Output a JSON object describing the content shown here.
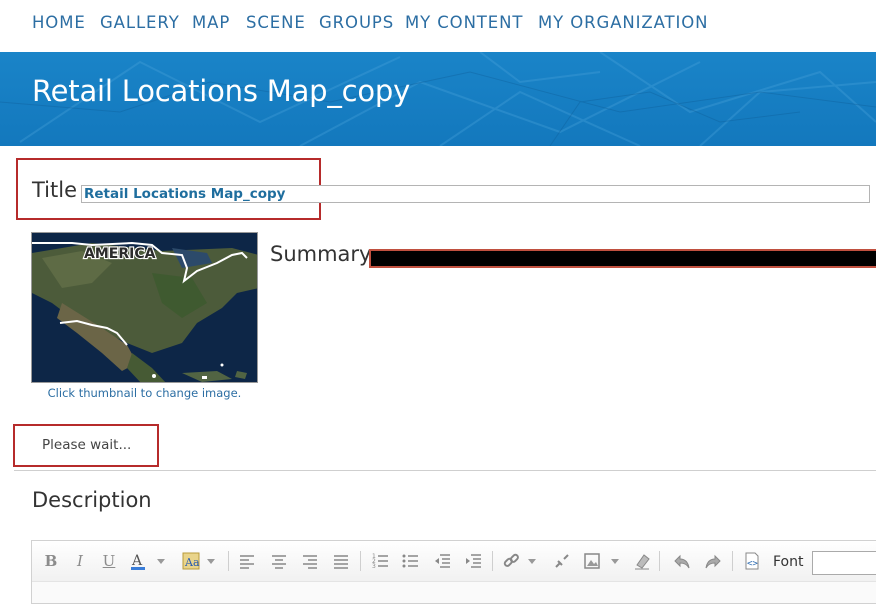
{
  "nav": {
    "items": [
      {
        "label": "HOME"
      },
      {
        "label": "GALLERY"
      },
      {
        "label": "MAP"
      },
      {
        "label": "SCENE"
      },
      {
        "label": "GROUPS"
      },
      {
        "label": "MY CONTENT"
      },
      {
        "label": "MY ORGANIZATION"
      }
    ]
  },
  "header": {
    "title": "Retail Locations Map_copy"
  },
  "form": {
    "title_label": "Title",
    "title_value": "Retail Locations Map_copy",
    "summary_label": "Summary",
    "thumbnail_text": "AMERICA",
    "thumbnail_caption": "Click thumbnail to change image.",
    "wait_text": "Please wait...",
    "description_label": "Description"
  },
  "editor": {
    "font_label": "Font",
    "toolbar_icons": [
      "bold-icon",
      "italic-icon",
      "underline-icon",
      "text-color-icon",
      "highlight-color-icon",
      "align-left-icon",
      "align-center-icon",
      "align-right-icon",
      "justify-icon",
      "numbered-list-icon",
      "bulleted-list-icon",
      "outdent-icon",
      "indent-icon",
      "create-link-icon",
      "unlink-icon",
      "insert-image-icon",
      "remove-format-icon",
      "undo-icon",
      "redo-icon",
      "view-source-icon"
    ]
  },
  "colors": {
    "nav_link": "#2c6ea3",
    "banner": "#1378bd",
    "highlight_box": "#b62b2b"
  }
}
